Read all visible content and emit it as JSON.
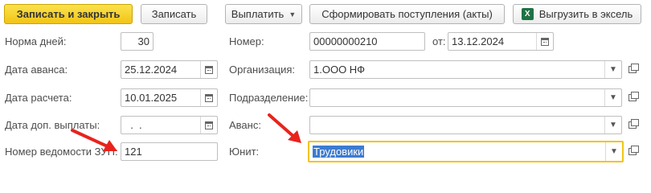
{
  "toolbar": {
    "save_close": "Записать и закрыть",
    "save": "Записать",
    "pay": "Выплатить",
    "form_receipts": "Сформировать поступления (акты)",
    "export_excel": "Выгрузить в эксель"
  },
  "form": {
    "days_norm": {
      "label": "Норма дней:",
      "value": "30"
    },
    "number": {
      "label": "Номер:",
      "value": "00000000210"
    },
    "from": {
      "label": "от:",
      "value": "13.12.2024"
    },
    "advance_date": {
      "label": "Дата аванса:",
      "value": "25.12.2024"
    },
    "organization": {
      "label": "Организация:",
      "value": "1.ООО НФ"
    },
    "calc_date": {
      "label": "Дата расчета:",
      "value": "10.01.2025"
    },
    "division": {
      "label": "Подразделение:",
      "value": ""
    },
    "extra_pay_date": {
      "label": "Дата доп. выплаты:",
      "value": "  .  ."
    },
    "advance": {
      "label": "Аванс:",
      "value": ""
    },
    "zup_sheet_number": {
      "label": "Номер ведомости ЗУП:",
      "value": "121"
    },
    "unit": {
      "label": "Юнит:",
      "value": "Трудовики"
    }
  },
  "icons": {
    "calendar": "calendar-icon",
    "dropdown": "chevron-down-icon",
    "open": "open-form-icon",
    "excel": "excel-icon"
  },
  "colors": {
    "primary_button": "#f2c415",
    "focus_border": "#f2c415",
    "annotation_arrow": "#e8231c",
    "selection": "#3d7bd1"
  }
}
